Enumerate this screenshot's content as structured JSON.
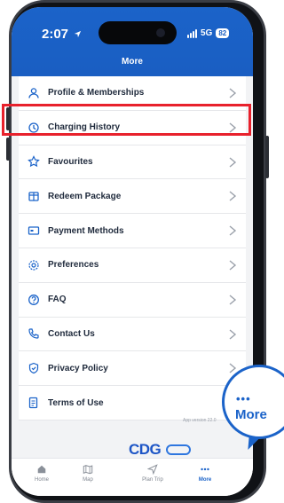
{
  "status_bar": {
    "time": "2:07",
    "network": "5G",
    "battery": "82"
  },
  "header": {
    "title": "More"
  },
  "menu": {
    "items": [
      {
        "label": "Profile & Memberships",
        "icon": "person-icon"
      },
      {
        "label": "Charging History",
        "icon": "history-icon"
      },
      {
        "label": "Favourites",
        "icon": "star-icon"
      },
      {
        "label": "Redeem Package",
        "icon": "package-icon"
      },
      {
        "label": "Payment Methods",
        "icon": "card-icon"
      },
      {
        "label": "Preferences",
        "icon": "settings-icon"
      },
      {
        "label": "FAQ",
        "icon": "question-icon"
      },
      {
        "label": "Contact Us",
        "icon": "phone-icon"
      },
      {
        "label": "Privacy Policy",
        "icon": "shield-icon"
      },
      {
        "label": "Terms of Use",
        "icon": "document-icon"
      }
    ]
  },
  "footer": {
    "version": "App version 22.0",
    "logo_text": "CDG"
  },
  "nav": {
    "items": [
      {
        "label": "Home",
        "icon": "home-icon"
      },
      {
        "label": "Map",
        "icon": "map-icon"
      },
      {
        "label": "Plan Trip",
        "icon": "navigation-icon"
      },
      {
        "label": "More",
        "icon": "more-icon"
      }
    ],
    "active": "More"
  },
  "callout": {
    "dots": "•••",
    "label": "More"
  },
  "colors": {
    "brand_blue": "#1b63c9",
    "highlight_red": "#e8212c"
  }
}
